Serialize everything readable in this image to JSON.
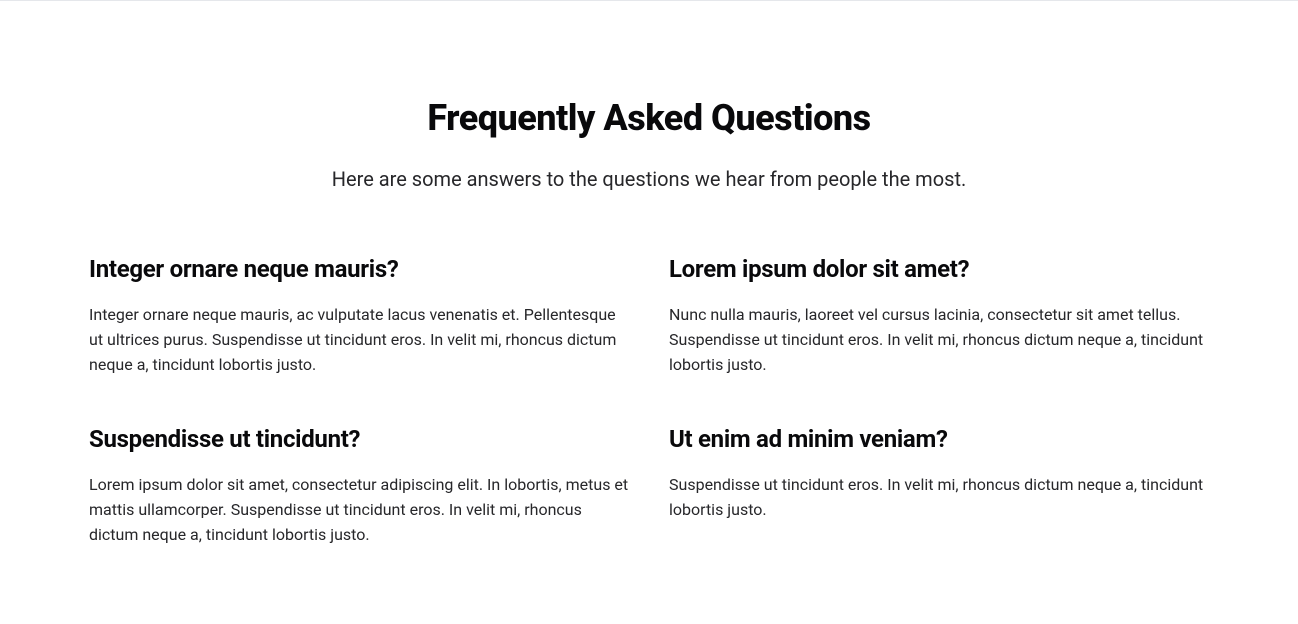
{
  "header": {
    "title": "Frequently Asked Questions",
    "subtitle": "Here are some answers to the questions we hear from people the most."
  },
  "faqs": [
    {
      "question": "Integer ornare neque mauris?",
      "answer": "Integer ornare neque mauris, ac vulputate lacus venenatis et. Pellentesque ut ultrices purus. Suspendisse ut tincidunt eros. In velit mi, rhoncus dictum neque a, tincidunt lobortis justo."
    },
    {
      "question": "Lorem ipsum dolor sit amet?",
      "answer": "Nunc nulla mauris, laoreet vel cursus lacinia, consectetur sit amet tellus. Suspendisse ut tincidunt eros. In velit mi, rhoncus dictum neque a, tincidunt lobortis justo."
    },
    {
      "question": "Suspendisse ut tincidunt?",
      "answer": "Lorem ipsum dolor sit amet, consectetur adipiscing elit. In lobortis, metus et mattis ullamcorper. Suspendisse ut tincidunt eros. In velit mi, rhoncus dictum neque a, tincidunt lobortis justo."
    },
    {
      "question": "Ut enim ad minim veniam?",
      "answer": "Suspendisse ut tincidunt eros. In velit mi, rhoncus dictum neque a, tincidunt lobortis justo."
    }
  ]
}
